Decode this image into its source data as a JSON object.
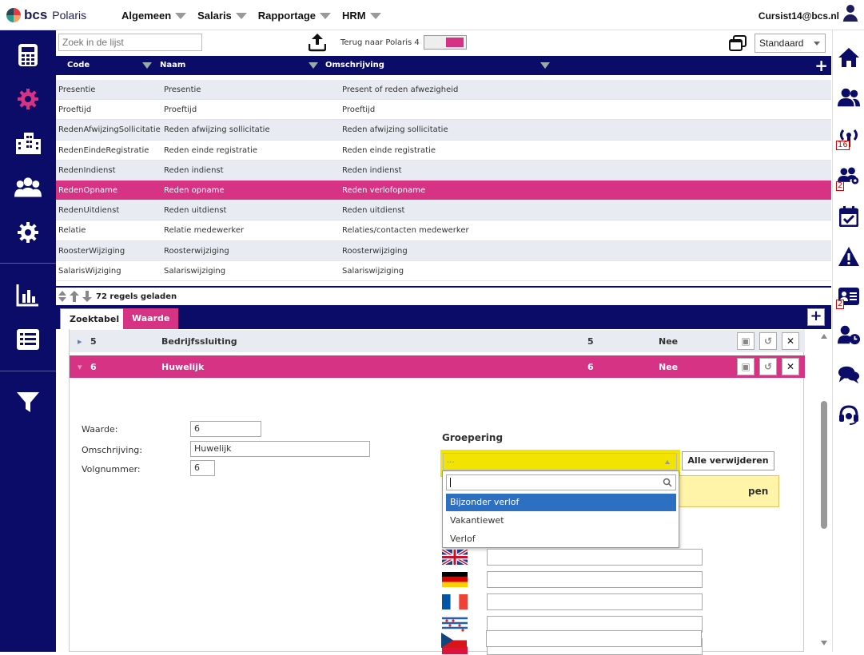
{
  "brand": {
    "logo_text": "bcs",
    "product": "Polaris"
  },
  "topmenu": [
    "Algemeen",
    "Salaris",
    "Rapportage",
    "HRM"
  ],
  "user": "Cursist14@bcs.nl",
  "toolbar": {
    "search_placeholder": "Zoek in de lijst",
    "terug_label": "Terug naar Polaris 4",
    "view_select": "Standaard"
  },
  "grid": {
    "columns": [
      "Code",
      "Naam",
      "Omschrijving"
    ],
    "rows": [
      {
        "code": "Presentie",
        "naam": "Presentie",
        "omschrijving": "Present of reden afwezigheid"
      },
      {
        "code": "Proeftijd",
        "naam": "Proeftijd",
        "omschrijving": "Proeftijd"
      },
      {
        "code": "RedenAfwijzingSollicitatie",
        "naam": "Reden afwijzing sollicitatie",
        "omschrijving": "Reden afwijzing sollicitatie"
      },
      {
        "code": "RedenEindeRegistratie",
        "naam": "Reden einde registratie",
        "omschrijving": "Reden einde registratie"
      },
      {
        "code": "RedenIndienst",
        "naam": "Reden indienst",
        "omschrijving": "Reden indienst"
      },
      {
        "code": "RedenOpname",
        "naam": "Reden opname",
        "omschrijving": "Reden verlofopname"
      },
      {
        "code": "RedenUitdienst",
        "naam": "Reden uitdienst",
        "omschrijving": "Reden uitdienst"
      },
      {
        "code": "Relatie",
        "naam": "Relatie medewerker",
        "omschrijving": "Relaties/contacten medewerker"
      },
      {
        "code": "RoosterWijziging",
        "naam": "Roosterwijziging",
        "omschrijving": "Roosterwijziging"
      },
      {
        "code": "SalarisWijziging",
        "naam": "Salariswijziging",
        "omschrijving": "Salariswijziging"
      }
    ],
    "selected_index": 5,
    "status": "72 regels geladen"
  },
  "tabs": [
    "Zoektabel",
    "Waarde"
  ],
  "detail": {
    "rows": [
      {
        "nr": "5",
        "naam": "Bijzonder verlof",
        "count": "5",
        "flag": "Nee"
      },
      {
        "nr": "6",
        "naam": "Huwelijk",
        "count": "6",
        "flag": "Nee"
      }
    ],
    "row1_naam": "Bedrijfssluiting",
    "form": {
      "waarde_label": "Waarde:",
      "waarde_value": "6",
      "omschrijving_label": "Omschrijving:",
      "omschrijving_value": "Huwelijk",
      "volgnummer_label": "Volgnummer:",
      "volgnummer_value": "6"
    },
    "groepering_label": "Groepering",
    "combo_value": "...",
    "alle_verwijderen": "Alle verwijderen",
    "yellow_text": "pen",
    "options": [
      "Bijzonder verlof",
      "Vakantiewet",
      "Verlof"
    ],
    "selected_option": 0
  },
  "rightbar_badges": {
    "antenna": "16",
    "team_settings": "2",
    "contact_card": "2"
  }
}
